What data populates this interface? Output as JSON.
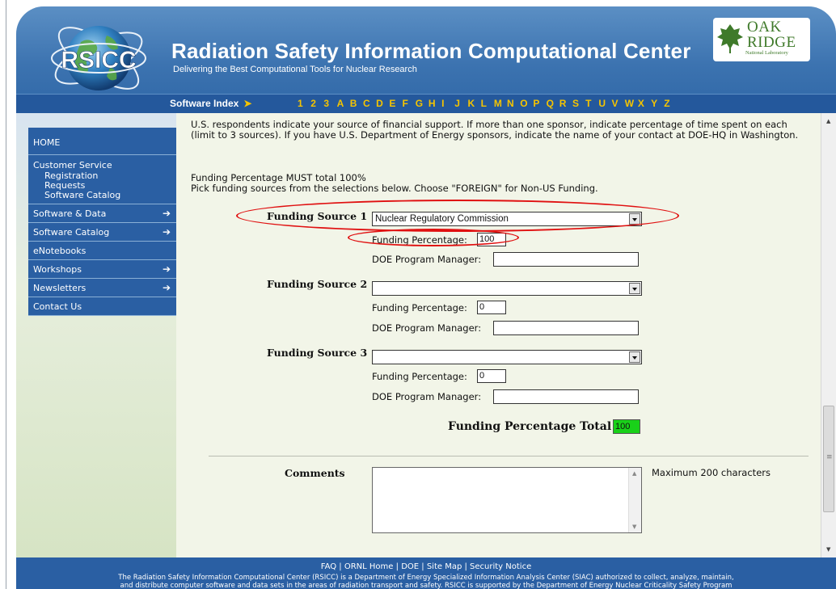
{
  "header": {
    "logo_text": "RSICC",
    "title": "Radiation Safety Information Computational Center",
    "subtitle": "Delivering the Best Computational Tools for Nuclear Research",
    "partner_logo": {
      "word1": "OAK",
      "word2": "RIDGE",
      "tagline": "National Laboratory"
    }
  },
  "nav": {
    "software_index_label": "Software Index",
    "letters": [
      "1",
      "2",
      "3",
      "A",
      "B",
      "C",
      "D",
      "E",
      "F",
      "G",
      "H",
      "I",
      "J",
      "K",
      "L",
      "M",
      "N",
      "O",
      "P",
      "Q",
      "R",
      "S",
      "T",
      "U",
      "V",
      "W",
      "X",
      "Y",
      "Z"
    ]
  },
  "sidebar": {
    "home": "HOME",
    "customer_service": {
      "label": "Customer Service",
      "subitems": [
        "Registration",
        "Requests",
        "Software Catalog"
      ]
    },
    "items": [
      {
        "label": "Software & Data",
        "arrow": true
      },
      {
        "label": "Software Catalog",
        "arrow": true
      },
      {
        "label": "eNotebooks",
        "arrow": false
      },
      {
        "label": "Workshops",
        "arrow": true
      },
      {
        "label": "Newsletters",
        "arrow": true
      },
      {
        "label": "Contact Us",
        "arrow": false
      }
    ]
  },
  "form": {
    "intro": "U.S. respondents indicate your source of financial support. If more than one sponsor, indicate percentage of time spent on each (limit to 3 sources). If you have U.S. Department of Energy sponsors, indicate the name of your contact at DOE-HQ in Washington.",
    "requirement_1": "Funding Percentage MUST total 100%",
    "requirement_2": "Pick funding sources from the selections below. Choose \"FOREIGN\" for Non-US Funding.",
    "sources": [
      {
        "label": "Funding Source 1",
        "selected": "Nuclear Regulatory Commission",
        "percentage_label": "Funding Percentage:",
        "percentage": "100",
        "manager_label": "DOE Program Manager:",
        "manager": ""
      },
      {
        "label": "Funding Source 2",
        "selected": "",
        "percentage_label": "Funding Percentage:",
        "percentage": "0",
        "manager_label": "DOE Program Manager:",
        "manager": ""
      },
      {
        "label": "Funding Source 3",
        "selected": "",
        "percentage_label": "Funding Percentage:",
        "percentage": "0",
        "manager_label": "DOE Program Manager:",
        "manager": ""
      }
    ],
    "total_label": "Funding Percentage Total",
    "total_value": "100",
    "comments_label": "Comments",
    "comments_value": "",
    "comments_note": "Maximum 200 characters"
  },
  "footer": {
    "links": [
      "FAQ",
      "ORNL Home",
      "DOE",
      "Site Map",
      "Security Notice"
    ],
    "separator": " | ",
    "text": "The Radiation Safety Information Computational Center (RSICC) is a Department of Energy Specialized Information Analysis Center (SIAC) authorized to collect, analyze, maintain, and distribute computer software and data sets in the areas of radiation transport and safety. RSICC is supported by the Department of Energy Nuclear Criticality Safety Program (NCSP) at Oak Ridge National Laboratory."
  },
  "colors": {
    "brand_blue": "#2a5fa3",
    "index_gold": "#f5c400",
    "total_green": "#19d119",
    "annotation_red": "#e01010"
  }
}
